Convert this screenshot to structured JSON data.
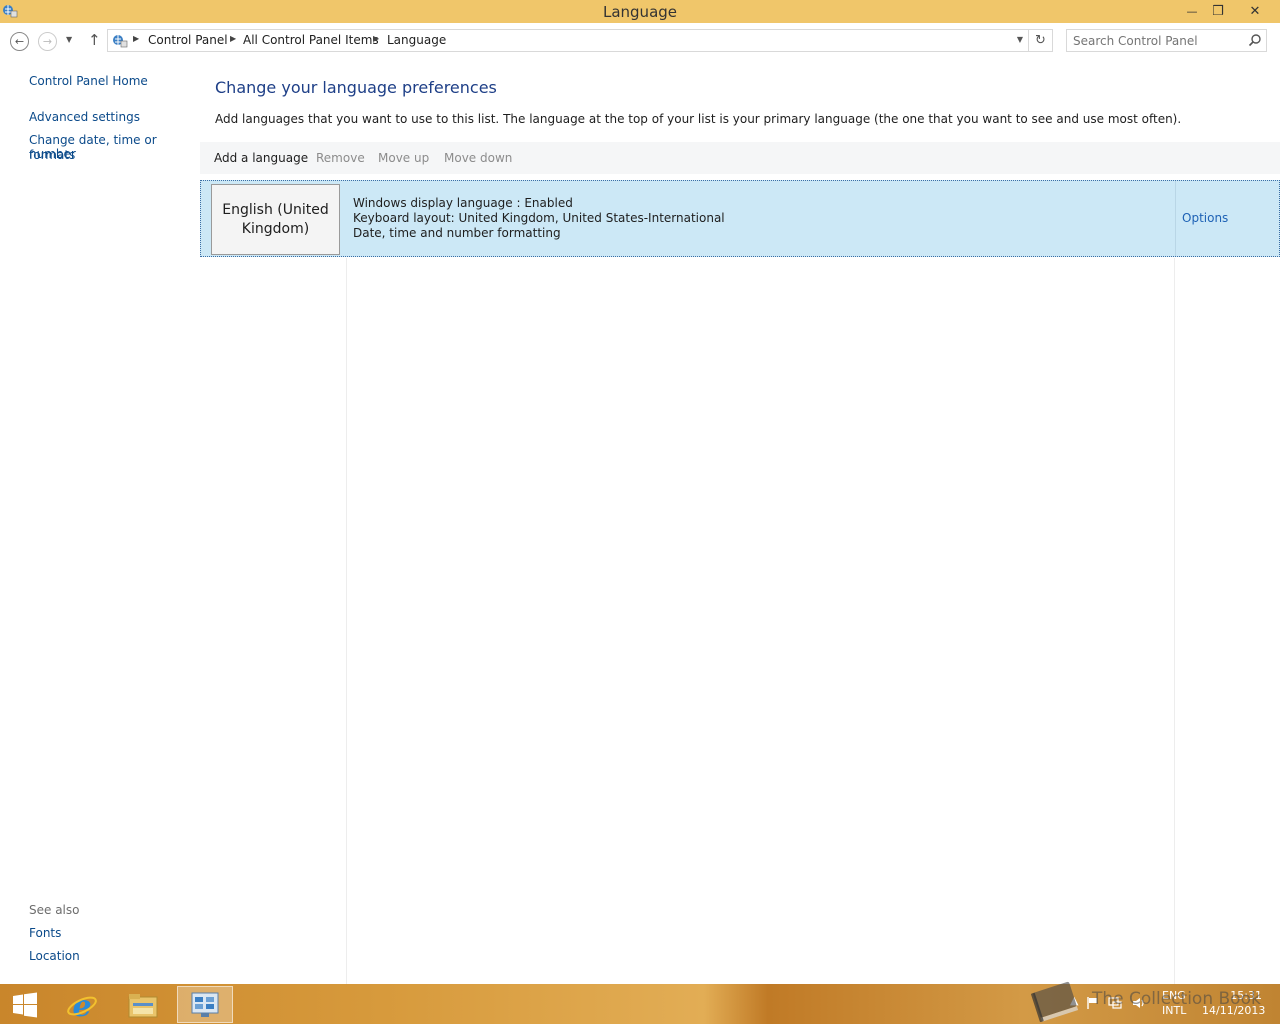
{
  "window": {
    "title": "Language",
    "minimize_label": "—",
    "maximize_label": "❒",
    "close_label": "✕"
  },
  "address": {
    "crumbs": [
      "Control Panel",
      "All Control Panel Items",
      "Language"
    ]
  },
  "search": {
    "placeholder": "Search Control Panel"
  },
  "sidebar": {
    "home": "Control Panel Home",
    "links": [
      "Advanced settings",
      "Change date, time or number",
      "formats"
    ],
    "see_also_title": "See also",
    "see_also": [
      "Fonts",
      "Location"
    ]
  },
  "main": {
    "heading": "Change your language preferences",
    "description": "Add languages that you want to use to this list. The language at the top of your list is your primary language (the one that you want to see and use most often).",
    "toolbar": {
      "add": "Add a language",
      "remove": "Remove",
      "move_up": "Move up",
      "move_down": "Move down"
    },
    "languages": [
      {
        "name_line1": "English (United",
        "name_line2": "Kingdom)",
        "details": [
          "Windows display language : Enabled",
          "Keyboard layout: United Kingdom, United States-International",
          "Date, time and number formatting"
        ],
        "options_label": "Options"
      }
    ]
  },
  "taskbar": {
    "tray": {
      "lang1": "ENG",
      "lang2": "INTL",
      "time": "15:31",
      "date": "14/11/2013"
    },
    "watermark": "The Collection Book"
  },
  "colors": {
    "titlebar": "#f0c66a",
    "link": "#0b4a8a",
    "heading": "#1e3f87",
    "selection": "#cce8f6"
  }
}
